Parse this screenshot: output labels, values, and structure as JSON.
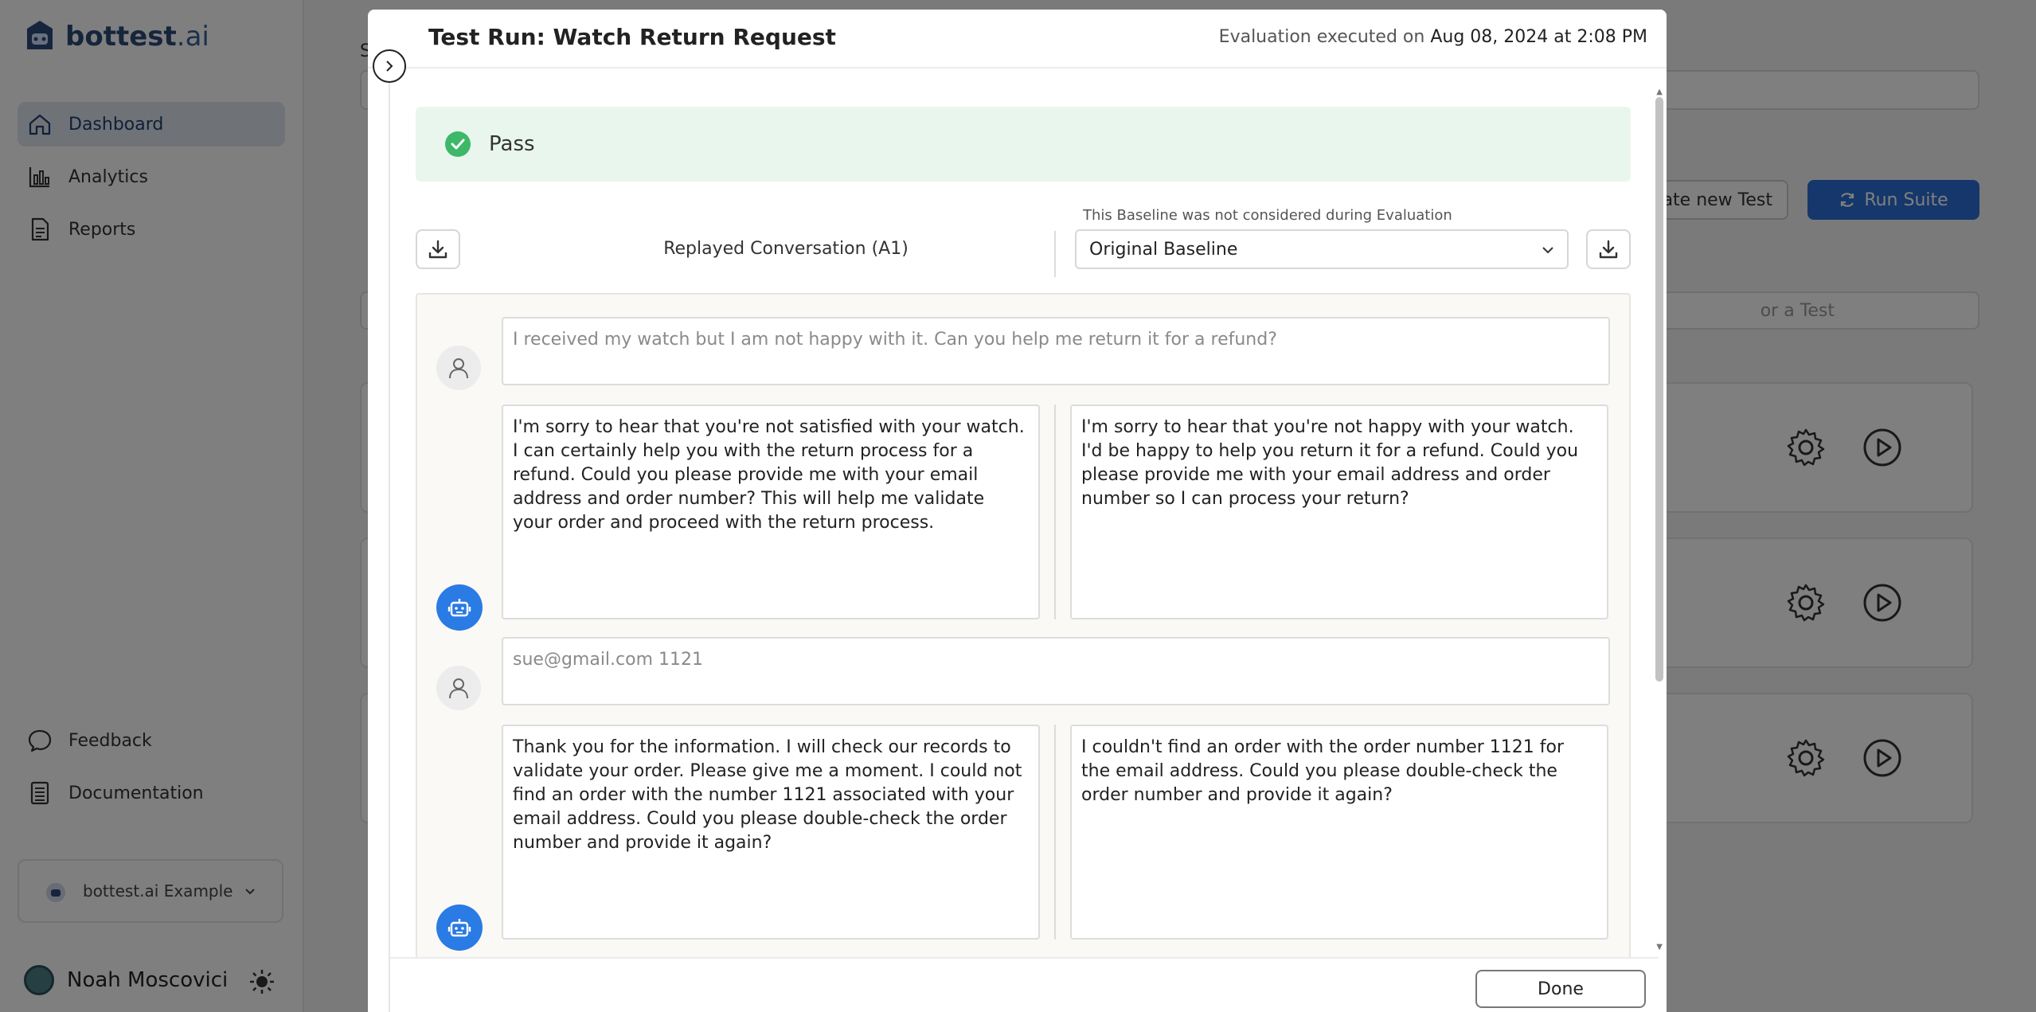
{
  "app": {
    "brand_name": "bottest",
    "brand_suffix": ".ai",
    "nav": [
      {
        "label": "Dashboard",
        "icon": "home-icon",
        "active": true
      },
      {
        "label": "Analytics",
        "icon": "bar-chart-icon",
        "active": false
      },
      {
        "label": "Reports",
        "icon": "document-icon",
        "active": false
      }
    ],
    "nav_bottom": [
      {
        "label": "Feedback",
        "icon": "chat-bubble-icon"
      },
      {
        "label": "Documentation",
        "icon": "book-icon"
      }
    ],
    "workspace": "bottest.ai Example",
    "user_name": "Noah Moscovici",
    "background": {
      "create_button": "ate new Test",
      "run_button": "Run Suite",
      "filter_placeholder": "or a Test"
    }
  },
  "modal": {
    "title": "Test Run: Watch Return Request",
    "executed_prefix": "Evaluation executed on ",
    "executed_date": "Aug 08, 2024 at 2:08 PM",
    "status": "Pass",
    "replayed_label": "Replayed Conversation (A1)",
    "baseline_note": "This Baseline was not considered during Evaluation",
    "baseline_selected": "Original Baseline",
    "done_label": "Done",
    "turns": [
      {
        "user": "I received my watch but I am not happy with it. Can you help me return it for a refund?",
        "bot_replay": "I'm sorry to hear that you're not satisfied with your watch. I can certainly help you with the return process for a refund. Could you please provide me with your email address and order number? This will help me validate your order and proceed with the return process.",
        "bot_baseline": "I'm sorry to hear that you're not happy with your watch. I'd be happy to help you return it for a refund. Could you please provide me with your email address and order number so I can process your return?"
      },
      {
        "user": "sue@gmail.com 1121",
        "bot_replay": "Thank you for the information. I will check our records to validate your order. Please give me a moment. I could not find an order with the number 1121 associated with your email address. Could you please double-check the order number and provide it again?",
        "bot_baseline": "I couldn't find an order with the order number 1121 for the email address. Could you please double-check the order number and provide it again?"
      }
    ]
  },
  "colors": {
    "accent": "#2a7be4",
    "pass_bg": "#e9f6ee",
    "pass_icon": "#3db868",
    "brand": "#2c4a78"
  }
}
